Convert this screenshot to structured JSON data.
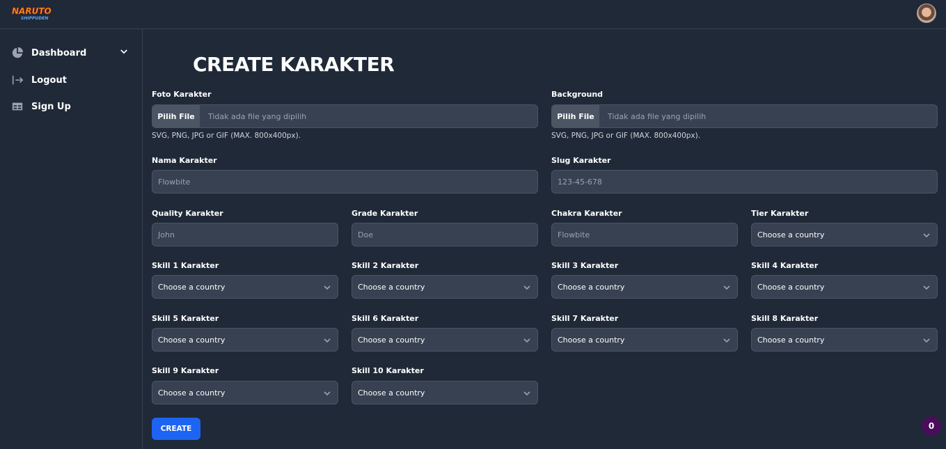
{
  "header": {
    "logo_text": "NARUTO",
    "logo_sub": "SHIPPUDEN"
  },
  "sidebar": {
    "items": [
      {
        "label": "Dashboard"
      },
      {
        "label": "Logout"
      },
      {
        "label": "Sign Up"
      }
    ]
  },
  "page": {
    "title": "CREATE KARAKTER"
  },
  "form": {
    "foto": {
      "label": "Foto Karakter",
      "button": "Pilih File",
      "status": "Tidak ada file yang dipilih",
      "help": "SVG, PNG, JPG or GIF (MAX. 800x400px)."
    },
    "background": {
      "label": "Background",
      "button": "Pilih File",
      "status": "Tidak ada file yang dipilih",
      "help": "SVG, PNG, JPG or GIF (MAX. 800x400px)."
    },
    "nama": {
      "label": "Nama Karakter",
      "placeholder": "Flowbite"
    },
    "slug": {
      "label": "Slug Karakter",
      "placeholder": "123-45-678"
    },
    "quality": {
      "label": "Quality Karakter",
      "placeholder": "John"
    },
    "grade": {
      "label": "Grade Karakter",
      "placeholder": "Doe"
    },
    "chakra": {
      "label": "Chakra Karakter",
      "placeholder": "Flowbite"
    },
    "tier": {
      "label": "Tier Karakter",
      "value": "Choose a country"
    },
    "skills": [
      {
        "label": "Skill 1 Karakter",
        "value": "Choose a country"
      },
      {
        "label": "Skill 2 Karakter",
        "value": "Choose a country"
      },
      {
        "label": "Skill 3 Karakter",
        "value": "Choose a country"
      },
      {
        "label": "Skill 4 Karakter",
        "value": "Choose a country"
      },
      {
        "label": "Skill 5 Karakter",
        "value": "Choose a country"
      },
      {
        "label": "Skill 6 Karakter",
        "value": "Choose a country"
      },
      {
        "label": "Skill 7 Karakter",
        "value": "Choose a country"
      },
      {
        "label": "Skill 8 Karakter",
        "value": "Choose a country"
      },
      {
        "label": "Skill 9 Karakter",
        "value": "Choose a country"
      },
      {
        "label": "Skill 10 Karakter",
        "value": "Choose a country"
      }
    ],
    "submit": "CREATE"
  },
  "notification_badge": "0"
}
